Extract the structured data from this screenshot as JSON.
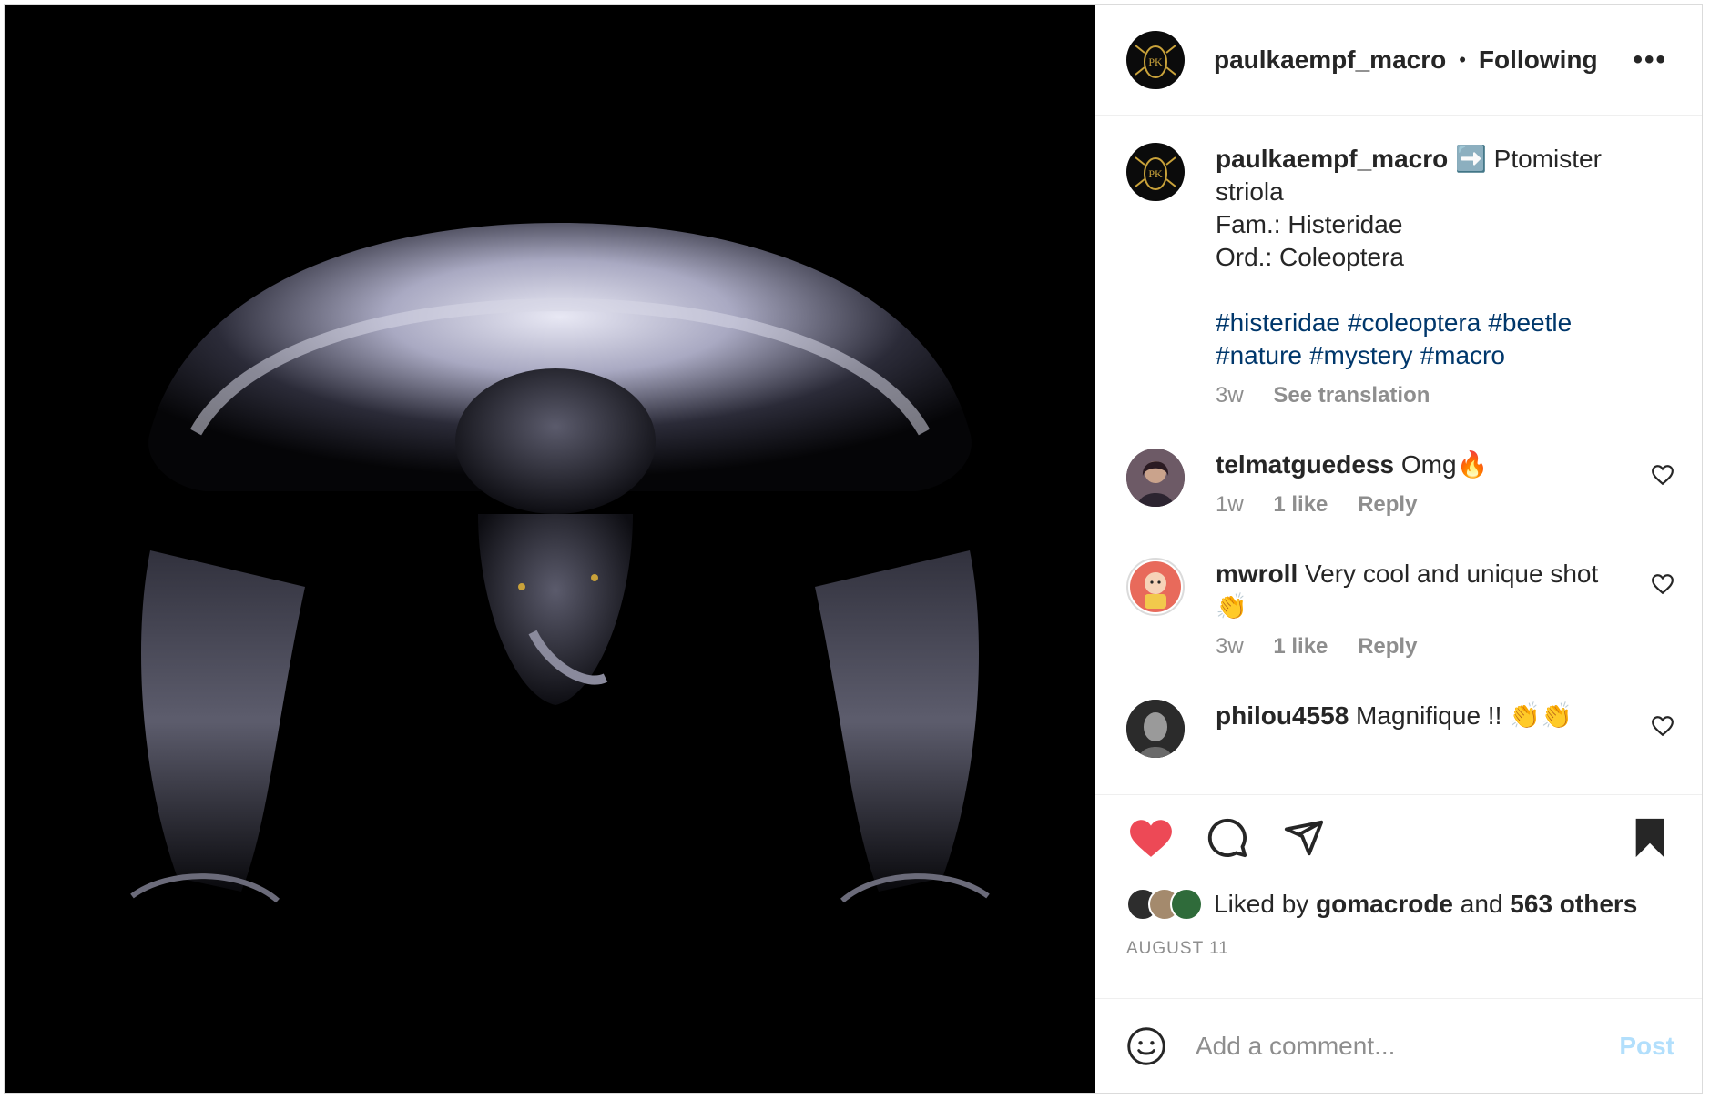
{
  "header": {
    "username": "paulkaempf_macro",
    "separator": "•",
    "follow_status": "Following",
    "more_label": "•••",
    "avatar_text": "PK"
  },
  "caption": {
    "username": "paulkaempf_macro",
    "arrow_emoji": "➡️",
    "line1": "Ptomister",
    "line2": "striola",
    "line3": "Fam.: Histeridae",
    "line4": "Ord.: Coleoptera",
    "hashtags_line1": [
      "#histeridae",
      "#coleoptera",
      "#beetle"
    ],
    "hashtags_line2": [
      "#nature",
      "#mystery",
      "#macro"
    ],
    "time": "3w",
    "see_translation": "See translation"
  },
  "comments": [
    {
      "username": "telmatguedess",
      "text": "Omg🔥",
      "time": "1w",
      "likes": "1 like",
      "reply": "Reply"
    },
    {
      "username": "mwroll",
      "text": "Very cool and unique shot 👏",
      "time": "3w",
      "likes": "1 like",
      "reply": "Reply"
    },
    {
      "username": "philou4558",
      "text": "Magnifique !! 👏👏",
      "time": "",
      "likes": "",
      "reply": ""
    }
  ],
  "likes": {
    "prefix": "Liked by",
    "user": "gomacrode",
    "middle": "and",
    "others": "563 others"
  },
  "date": "AUGUST 11",
  "add_comment": {
    "placeholder": "Add a comment...",
    "post_label": "Post"
  },
  "colors": {
    "like_red": "#ed4956",
    "link_blue": "#00376b",
    "post_disabled": "#b2dffc",
    "gold": "#c9a23a"
  }
}
